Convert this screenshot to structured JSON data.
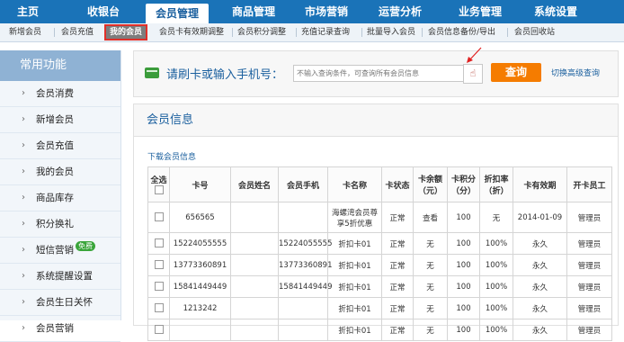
{
  "top_nav": [
    "主页",
    "收银台",
    "会员管理",
    "商品管理",
    "市场营销",
    "运营分析",
    "业务管理",
    "系统设置"
  ],
  "sub_nav": [
    "新增会员",
    "会员充值",
    "我的会员",
    "会员卡有效期调整",
    "会员积分调整",
    "充值记录查询",
    "批量导入会员",
    "会员信息备份/导出",
    "会员回收站"
  ],
  "sidebar": {
    "title": "常用功能",
    "items": [
      {
        "label": "会员消费"
      },
      {
        "label": "新增会员"
      },
      {
        "label": "会员充值"
      },
      {
        "label": "我的会员"
      },
      {
        "label": "商品库存"
      },
      {
        "label": "积分换礼"
      },
      {
        "label": "短信营销",
        "badge": "免费"
      },
      {
        "label": "系统提醒设置"
      },
      {
        "label": "会员生日关怀"
      },
      {
        "label": "会员营销"
      }
    ]
  },
  "search": {
    "label": "请刷卡或输入手机号：",
    "placeholder": "不输入查询条件，可查询所有会员信息",
    "query_btn": "查询",
    "advanced": "切换高级查询"
  },
  "panel": {
    "title": "会员信息",
    "download": "下载会员信息",
    "headers": [
      "全选",
      "卡号",
      "会员姓名",
      "会员手机",
      "卡名称",
      "卡状态",
      "卡余额（元）",
      "卡积分（分）",
      "折扣率（折）",
      "卡有效期",
      "开卡员工"
    ],
    "rows": [
      [
        "656565",
        "",
        "",
        "海螺湾会员尊享5折优惠",
        "正常",
        "查看",
        "100",
        "无",
        "2014-01-09",
        "管理员"
      ],
      [
        "15224055555",
        "",
        "15224055555",
        "折扣卡01",
        "正常",
        "无",
        "100",
        "100%",
        "永久",
        "管理员"
      ],
      [
        "13773360891",
        "",
        "13773360891",
        "折扣卡01",
        "正常",
        "无",
        "100",
        "100%",
        "永久",
        "管理员"
      ],
      [
        "15841449449",
        "",
        "15841449449",
        "折扣卡01",
        "正常",
        "无",
        "100",
        "100%",
        "永久",
        "管理员"
      ],
      [
        "1213242",
        "",
        "",
        "折扣卡01",
        "正常",
        "无",
        "100",
        "100%",
        "永久",
        "管理员"
      ],
      [
        "",
        "",
        "",
        "折扣卡01",
        "正常",
        "无",
        "100",
        "100%",
        "永久",
        "管理员"
      ]
    ]
  }
}
